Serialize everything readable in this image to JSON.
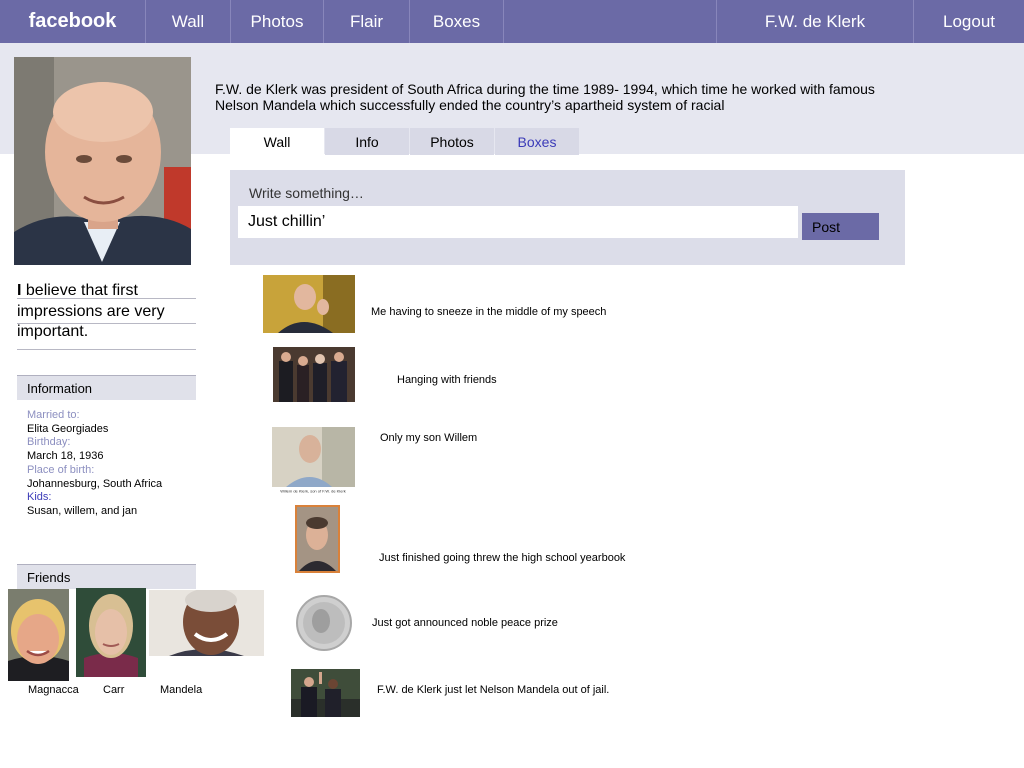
{
  "nav": {
    "logo": "facebook",
    "items": [
      "Wall",
      "Photos",
      "Flair",
      "Boxes"
    ],
    "user": "F.W. de Klerk",
    "logout": "Logout"
  },
  "profile": {
    "bio": "F.W. de Klerk was president of South Africa during the time 1989- 1994, which time he worked with famous Nelson Mandela which successfully ended the country’s apartheid system of racial",
    "quote_first": "I",
    "quote_rest": " believe that first impressions are very important."
  },
  "tabs": [
    "Wall",
    "Info",
    "Photos",
    "Boxes"
  ],
  "composer": {
    "label": "Write something…",
    "value": "Just chillin’",
    "post": "Post"
  },
  "information": {
    "header": "Information",
    "fields": [
      {
        "label": "Married to:",
        "value": "Elita Georgiades"
      },
      {
        "label": "Birthday:",
        "value": "March 18, 1936"
      },
      {
        "label": "Place of birth:",
        "value": "Johannesburg, South Africa"
      },
      {
        "label": "Kids:",
        "value": "Susan, willem, and jan"
      }
    ]
  },
  "friends": {
    "header": "Friends",
    "names": [
      "Magnacca",
      "Carr",
      "Mandela"
    ]
  },
  "feed": [
    "Me having to sneeze in the middle of my speech",
    "Hanging with friends",
    "Only my son Willem",
    "Just finished going threw the high school yearbook",
    "Just got announced noble peace prize",
    "F.W. de Klerk just let Nelson Mandela out of jail."
  ],
  "photo_caption": "Willem de Klerk, son of F.W. de Klerk",
  "colors": {
    "brand": "#6b6aa6",
    "panel": "#dcdde9",
    "band": "#e6e7f0",
    "link": "#3b3bb8",
    "muted_label": "#8c8fc0"
  }
}
